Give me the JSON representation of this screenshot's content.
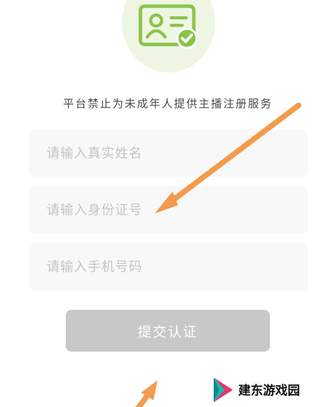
{
  "header": {
    "icon": "id-card-verified-icon",
    "notice": "平台禁止为未成年人提供主播注册服务"
  },
  "form": {
    "name_placeholder": "请输入真实姓名",
    "id_placeholder": "请输入身份证号",
    "phone_placeholder": "请输入手机号码",
    "submit_label": "提交认证"
  },
  "watermark": {
    "text": "建东游戏园"
  },
  "colors": {
    "accent_green": "#8bc34a",
    "circle_bg": "#eef6e3",
    "arrow_orange": "#f39a4c",
    "button_disabled": "#c8c8c8",
    "field_bg": "#f8f8f8",
    "placeholder": "#c4c4c4"
  }
}
